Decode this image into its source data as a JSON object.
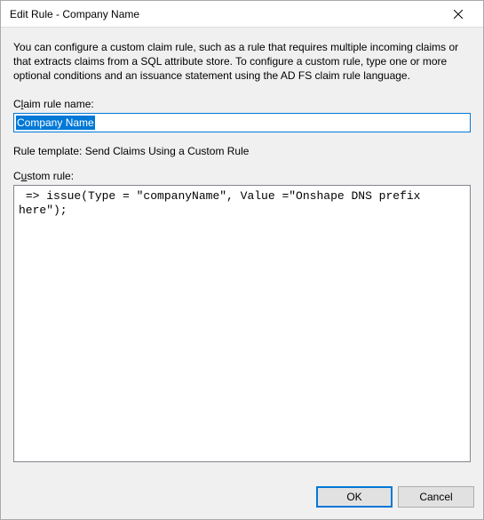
{
  "window": {
    "title": "Edit Rule - Company Name",
    "close_icon": "close"
  },
  "intro": "You can configure a custom claim rule, such as a rule that requires multiple incoming claims or that extracts claims from a SQL attribute store. To configure a custom rule, type one or more optional conditions and an issuance statement using the AD FS claim rule language.",
  "claim_rule_name": {
    "label_pre": "C",
    "label_ul": "l",
    "label_post": "aim rule name:",
    "value": "Company Name"
  },
  "template_line": "Rule template: Send Claims Using a Custom Rule",
  "custom_rule": {
    "label_pre": "C",
    "label_ul": "u",
    "label_post": "stom rule:",
    "value": " => issue(Type = \"companyName\", Value =\"Onshape DNS prefix here\");"
  },
  "buttons": {
    "ok": "OK",
    "cancel": "Cancel"
  }
}
